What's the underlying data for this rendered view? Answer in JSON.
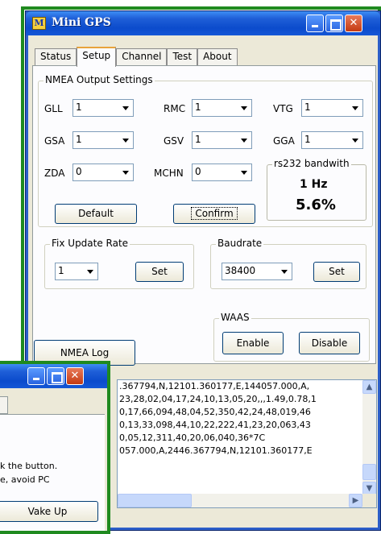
{
  "window": {
    "title": "Mini GPS",
    "icon_letter": "M",
    "controls": [
      "minimize-icon",
      "maximize-icon",
      "close-icon"
    ]
  },
  "tabs": [
    "Status",
    "Setup",
    "Channel",
    "Test",
    "About"
  ],
  "active_tab": "Setup",
  "nmea": {
    "group_label": "NMEA Output Settings",
    "fields": [
      {
        "label": "GLL",
        "value": "1"
      },
      {
        "label": "RMC",
        "value": "1"
      },
      {
        "label": "VTG",
        "value": "1"
      },
      {
        "label": "GSA",
        "value": "1"
      },
      {
        "label": "GSV",
        "value": "1"
      },
      {
        "label": "GGA",
        "value": "1"
      },
      {
        "label": "ZDA",
        "value": "0"
      },
      {
        "label": "MCHN",
        "value": "0"
      }
    ],
    "default_button": "Default",
    "confirm_button": "Confirm"
  },
  "bandwidth": {
    "group_label": "rs232 bandwith",
    "rate": "1 Hz",
    "percent": "5.6%"
  },
  "fix_rate": {
    "group_label": "Fix Update Rate",
    "value": "1",
    "set_button": "Set"
  },
  "baudrate": {
    "group_label": "Baudrate",
    "value": "38400",
    "set_button": "Set"
  },
  "waas": {
    "group_label": "WAAS",
    "enable_button": "Enable",
    "disable_button": "Disable"
  },
  "nmea_log_button": "NMEA Log",
  "log_lines": [
    ".367794,N,12101.360177,E,144057.000,A,",
    "23,28,02,04,17,24,10,13,05,20,,,1.49,0.78,1",
    "0,17,66,094,48,04,52,350,42,24,48,019,46",
    "0,13,33,098,44,10,22,222,41,23,20,063,43",
    "0,05,12,311,40,20,06,040,36*7C",
    "057.000,A,2446.367794,N,12101.360177,E"
  ],
  "second_window": {
    "text_lines": [
      "k the button.",
      "e, avoid PC"
    ],
    "wake_button": "Vake Up"
  },
  "colors": {
    "highlight_frame": "#1f8a1f",
    "titlebar": "#0b4bcc",
    "dialog_bg": "#ece9d8"
  }
}
